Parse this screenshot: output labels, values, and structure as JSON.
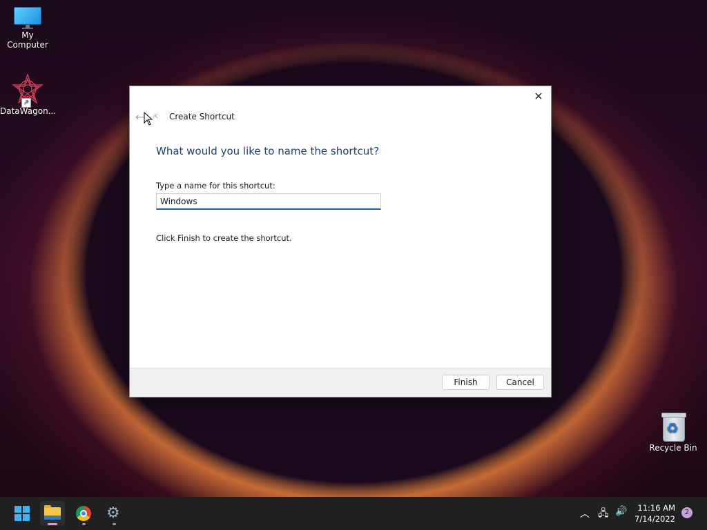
{
  "desktop": {
    "icons": [
      {
        "label": "My Computer"
      },
      {
        "label": "DataWagon..."
      },
      {
        "label": "Recycle Bin"
      }
    ]
  },
  "dialog": {
    "close_glyph": "✕",
    "back_glyph": "←",
    "title": "Create Shortcut",
    "question": "What would you like to name the shortcut?",
    "field_label": "Type a name for this shortcut:",
    "name_value": "Windows",
    "hint": "Click Finish to create the shortcut.",
    "finish_label": "Finish",
    "cancel_label": "Cancel"
  },
  "taskbar": {
    "items": [
      "start",
      "file-explorer",
      "chrome",
      "settings"
    ],
    "tray": {
      "time": "11:16 AM",
      "date": "7/14/2022",
      "notification_count": "2"
    }
  },
  "colors": {
    "accent": "#1a5fb4",
    "heading": "#1d3f7a",
    "taskbar": "#202020"
  }
}
